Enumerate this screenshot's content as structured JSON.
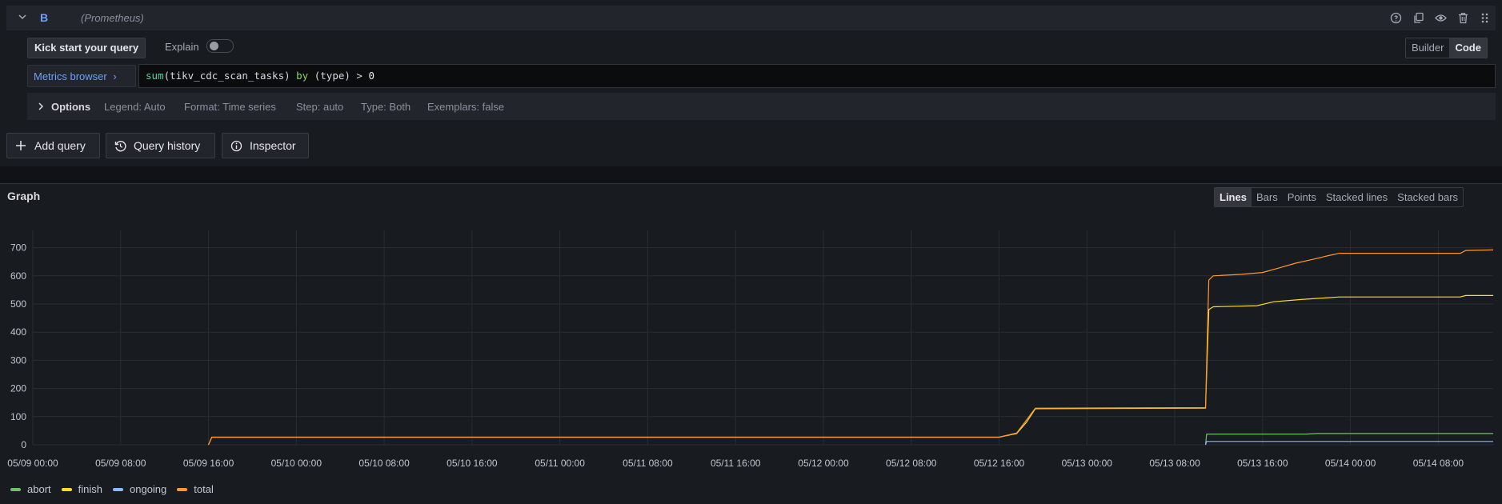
{
  "query": {
    "ref_id": "B",
    "datasource": "(Prometheus)",
    "header_icons": [
      "help-icon",
      "duplicate-icon",
      "eye-icon",
      "trash-icon",
      "drag-handle-icon"
    ],
    "kick_start_label": "Kick start your query",
    "explain_label": "Explain",
    "explain_enabled": false,
    "mode_builder": "Builder",
    "mode_code": "Code",
    "active_mode": "Code",
    "metrics_browser_label": "Metrics browser",
    "expr_fn": "sum",
    "expr_metric": "(tikv_cdc_scan_tasks)",
    "expr_by": "by",
    "expr_group": "(type)",
    "expr_op": " > ",
    "expr_num": "0",
    "options": {
      "title": "Options",
      "legend": "Legend: Auto",
      "format": "Format: Time series",
      "step": "Step: auto",
      "type": "Type: Both",
      "exemplars": "Exemplars: false"
    }
  },
  "actions": {
    "add_query": "Add query",
    "query_history": "Query history",
    "inspector": "Inspector"
  },
  "graph": {
    "title": "Graph",
    "viz_modes": [
      "Lines",
      "Bars",
      "Points",
      "Stacked lines",
      "Stacked bars"
    ],
    "active_viz": "Lines"
  },
  "chart_data": {
    "type": "line",
    "title": "",
    "xlabel": "",
    "ylabel": "",
    "ylim": [
      0,
      750
    ],
    "yticks": [
      0,
      100,
      200,
      300,
      400,
      500,
      600,
      700
    ],
    "xlim_hours": [
      0,
      133
    ],
    "xticks": [
      "05/09 00:00",
      "05/09 08:00",
      "05/09 16:00",
      "05/10 00:00",
      "05/10 08:00",
      "05/10 16:00",
      "05/11 00:00",
      "05/11 08:00",
      "05/11 16:00",
      "05/12 00:00",
      "05/12 08:00",
      "05/12 16:00",
      "05/13 00:00",
      "05/13 08:00",
      "05/13 16:00",
      "05/14 00:00",
      "05/14 08:00"
    ],
    "grid": true,
    "legend_position": "bottom-left",
    "series": [
      {
        "name": "abort",
        "color": "#73bf69",
        "points": [
          [
            106.8,
            0
          ],
          [
            106.9,
            38
          ],
          [
            116,
            38
          ],
          [
            117,
            40
          ],
          [
            133,
            40
          ]
        ]
      },
      {
        "name": "finish",
        "color": "#fade2a",
        "points": [
          [
            16,
            0
          ],
          [
            16.3,
            27
          ],
          [
            88,
            27
          ],
          [
            89.6,
            40
          ],
          [
            90.5,
            80
          ],
          [
            91.3,
            128
          ],
          [
            106.8,
            130
          ],
          [
            107.1,
            480
          ],
          [
            107.5,
            490
          ],
          [
            111.5,
            494
          ],
          [
            113,
            508
          ],
          [
            115.5,
            516
          ],
          [
            119,
            525
          ],
          [
            130,
            525
          ],
          [
            130.5,
            530
          ],
          [
            133,
            530
          ]
        ]
      },
      {
        "name": "ongoing",
        "color": "#8ab8ff",
        "points": [
          [
            106.8,
            0
          ],
          [
            106.9,
            12
          ],
          [
            133,
            12
          ]
        ]
      },
      {
        "name": "total",
        "color": "#ff9830",
        "points": [
          [
            16,
            0
          ],
          [
            16.3,
            27
          ],
          [
            88,
            27
          ],
          [
            89.6,
            42
          ],
          [
            90.5,
            88
          ],
          [
            91.3,
            130
          ],
          [
            106.8,
            132
          ],
          [
            107.1,
            585
          ],
          [
            107.5,
            600
          ],
          [
            110,
            605
          ],
          [
            112,
            612
          ],
          [
            113.5,
            628
          ],
          [
            115,
            645
          ],
          [
            116.5,
            658
          ],
          [
            118,
            672
          ],
          [
            119,
            680
          ],
          [
            130,
            680
          ],
          [
            130.5,
            690
          ],
          [
            133,
            692
          ]
        ]
      }
    ]
  }
}
